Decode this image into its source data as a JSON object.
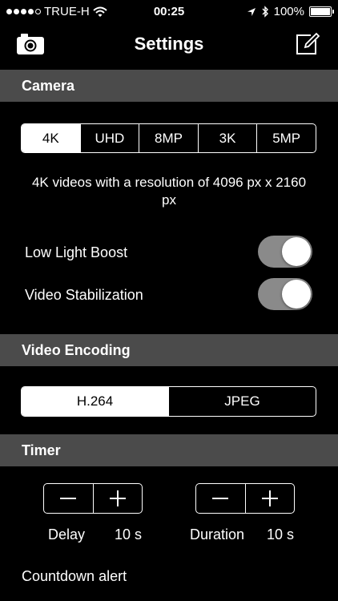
{
  "status_bar": {
    "carrier": "TRUE-H",
    "time": "00:25",
    "battery": "100%",
    "icons": [
      "signal-dots-icon",
      "wifi-icon",
      "location-arrow-icon",
      "bluetooth-icon",
      "battery-icon"
    ]
  },
  "nav": {
    "title": "Settings",
    "left_icon": "camera-icon",
    "right_icon": "edit-icon"
  },
  "camera": {
    "header": "Camera",
    "resolutions": [
      "4K",
      "UHD",
      "8MP",
      "3K",
      "5MP"
    ],
    "selected_resolution": "4K",
    "description": "4K videos with a resolution of 4096 px x 2160 px",
    "low_light_boost": {
      "label": "Low Light Boost",
      "on": true
    },
    "video_stabilization": {
      "label": "Video Stabilization",
      "on": true
    }
  },
  "video_encoding": {
    "header": "Video Encoding",
    "options": [
      "H.264",
      "JPEG"
    ],
    "selected": "H.264"
  },
  "timer": {
    "header": "Timer",
    "delay": {
      "label": "Delay",
      "value": "10 s"
    },
    "duration": {
      "label": "Duration",
      "value": "10 s"
    },
    "countdown_alert": "Countdown alert"
  }
}
